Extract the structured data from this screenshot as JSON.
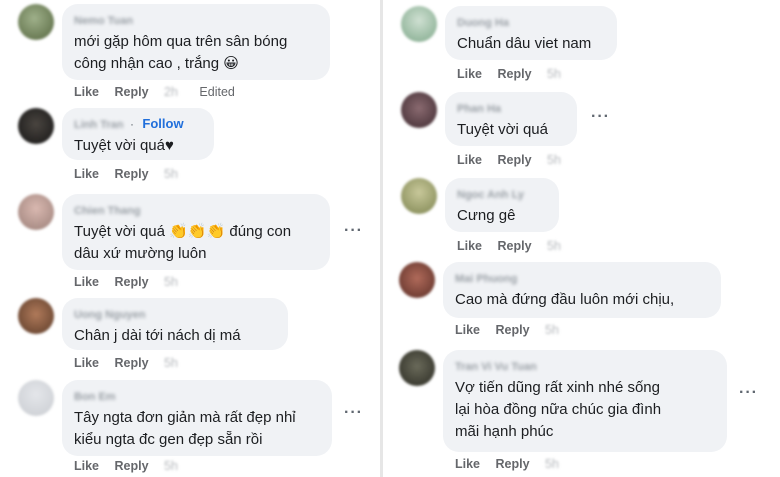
{
  "left": {
    "comments": [
      {
        "author": "Nemo Tuan",
        "text_lines": [
          "mới gặp hôm qua trên sân bóng",
          "công nhận cao , trắng 😀"
        ],
        "like": "Like",
        "reply": "Reply",
        "time": "2h",
        "edited": "Edited"
      },
      {
        "author": "Linh Tran",
        "follow": "Follow",
        "text_lines": [
          "Tuyệt vời quá♥"
        ],
        "like": "Like",
        "reply": "Reply",
        "time": "5h"
      },
      {
        "author": "Chien Thang",
        "text_lines": [
          "Tuyệt vời quá 👏👏👏 đúng con",
          "dâu xứ mường luôn"
        ],
        "like": "Like",
        "reply": "Reply",
        "time": "5h"
      },
      {
        "author": "Uong Nguyen",
        "text_lines": [
          "Chân j dài tới nách dị má"
        ],
        "like": "Like",
        "reply": "Reply",
        "time": "5h"
      },
      {
        "author": "Bon Em",
        "text_lines": [
          "Tây ngta đơn giản mà rất đẹp nhỉ",
          "kiểu ngta đc gen đẹp sẵn rồi"
        ],
        "like": "Like",
        "reply": "Reply",
        "time": "5h"
      }
    ]
  },
  "right": {
    "comments": [
      {
        "author": "Duong Ha",
        "text_lines": [
          "Chuẩn dâu viet nam"
        ],
        "like": "Like",
        "reply": "Reply",
        "time": "5h"
      },
      {
        "author": "Phan Ha",
        "text_lines": [
          "Tuyệt vời quá"
        ],
        "like": "Like",
        "reply": "Reply",
        "time": "5h"
      },
      {
        "author": "Ngoc Anh Ly",
        "text_lines": [
          "Cưng gê"
        ],
        "like": "Like",
        "reply": "Reply",
        "time": "5h"
      },
      {
        "author": "Mai Phuong",
        "text_lines": [
          "Cao mà đứng đầu luôn mới chịu,"
        ],
        "like": "Like",
        "reply": "Reply",
        "time": "5h"
      },
      {
        "author": "Tran Vi Vu Tuan",
        "text_lines": [
          "Vợ tiến dũng rất xinh nhé sống",
          "lại hòa đồng nữa chúc gia đình",
          "mãi hạnh phúc"
        ],
        "like": "Like",
        "reply": "Reply",
        "time": "5h"
      }
    ]
  },
  "more_label": "···",
  "colors": {
    "bubble": "#f0f2f5",
    "follow": "#216fdb",
    "text": "#1c1e21",
    "meta": "#65676b"
  }
}
